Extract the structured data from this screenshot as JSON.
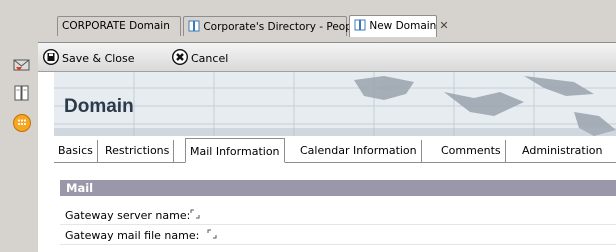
{
  "tabs": [
    {
      "label": "CORPORATE Domain",
      "closable": false,
      "icon": null
    },
    {
      "label": "Corporate's Directory - People",
      "closable": true,
      "icon": "address-book-icon"
    },
    {
      "label": "New Domain",
      "closable": true,
      "icon": "document-icon"
    }
  ],
  "toolbar": {
    "save_close_label": "Save & Close",
    "cancel_label": "Cancel"
  },
  "form": {
    "title": "Domain"
  },
  "section_tabs": [
    {
      "label": "Basics"
    },
    {
      "label": "Restrictions"
    },
    {
      "label": "Mail Information"
    },
    {
      "label": "Calendar Information"
    },
    {
      "label": "Comments"
    },
    {
      "label": "Administration"
    }
  ],
  "section": {
    "title": "Mail"
  },
  "fields": [
    {
      "label": "Gateway server name:",
      "value": ""
    },
    {
      "label": "Gateway mail file name:",
      "value": ""
    }
  ],
  "colors": {
    "band": "#9b97aa",
    "header_bg": "#e7ecf0",
    "chrome": "#d6d3ce"
  }
}
